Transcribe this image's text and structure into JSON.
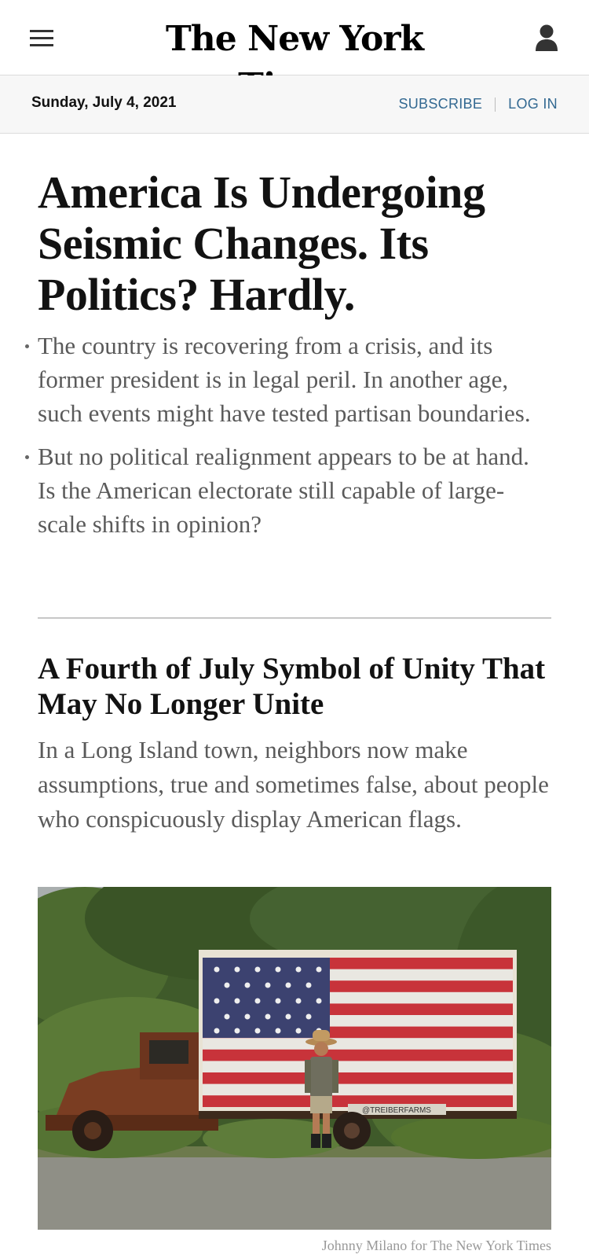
{
  "header": {
    "logo_text": "The New York Times",
    "menu_icon": "hamburger-menu-icon",
    "user_icon": "user-account-icon"
  },
  "datebar": {
    "date": "Sunday, July 4, 2021",
    "subscribe_label": "SUBSCRIBE",
    "login_label": "LOG IN",
    "link_color": "#326891"
  },
  "lead_story": {
    "headline": "America Is Undergoing Seismic Changes. Its Politics? Hardly.",
    "summary": [
      "The country is recovering from a crisis, and its former president is in legal peril. In another age, such events might have tested partisan boundaries.",
      "But no political realignment appears to be at hand. Is the American electorate still capable of large-scale shifts in opinion?"
    ]
  },
  "second_story": {
    "headline": "A Fourth of July Symbol of Unity That May No Longer Unite",
    "summary": "In a Long Island town, neighbors now make assumptions, true and sometimes false, about people who conspicuously display American flags.",
    "photo_credit": "Johnny Milano for The New York Times",
    "photo_sign_text": "@TREIBERFARMS"
  }
}
